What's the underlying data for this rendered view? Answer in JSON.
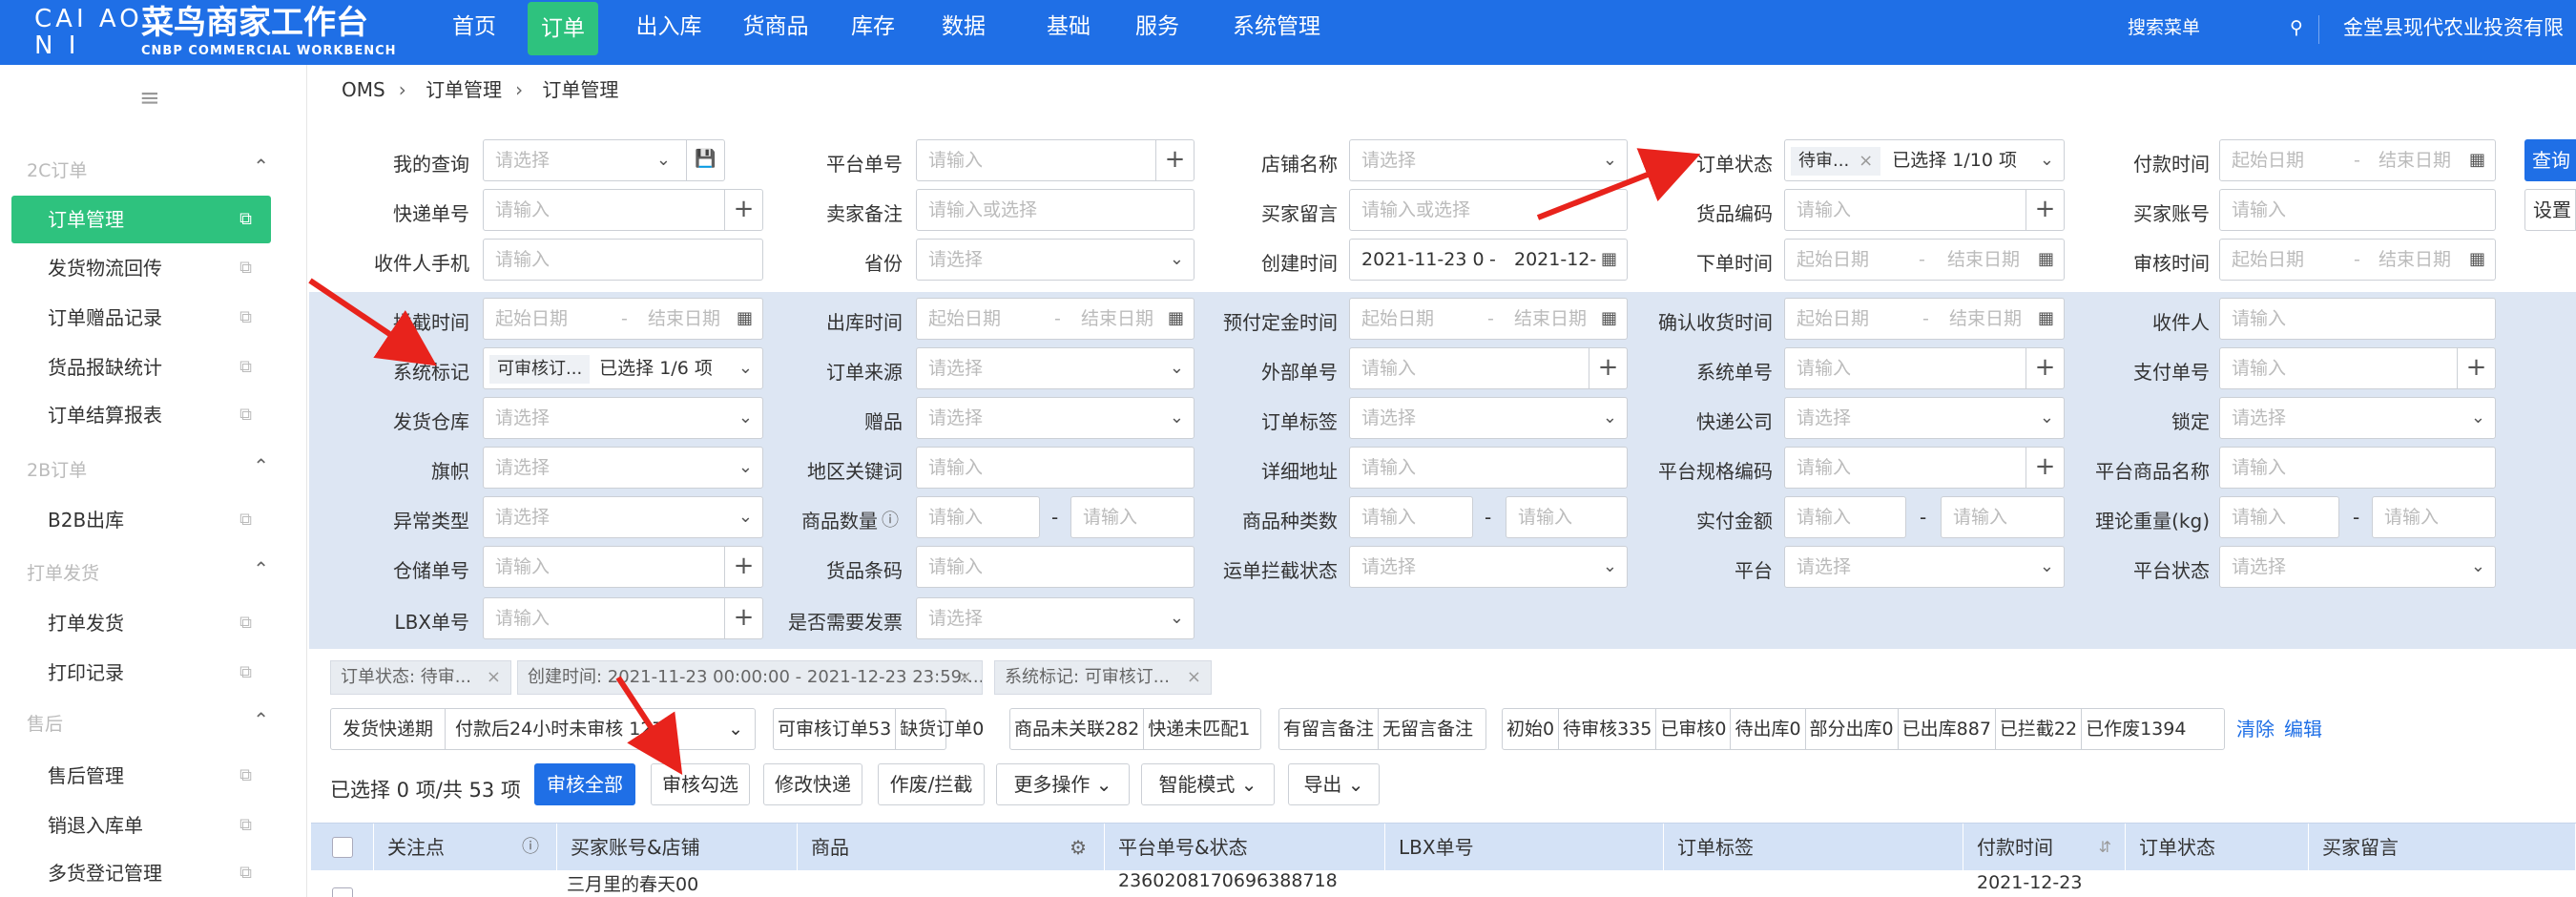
{
  "brand": {
    "logo_line1": "CAI AO",
    "logo_line2": "N I",
    "title": "菜鸟商家工作台",
    "subtitle": "CNBP COMMERCIAL WORKBENCH"
  },
  "nav": [
    "首页",
    "订单",
    "出入库",
    "货商品",
    "库存",
    "数据",
    "基础",
    "服务",
    "系统管理"
  ],
  "topbar": {
    "search_label": "搜索菜单",
    "company": "金堂县现代农业投资有限"
  },
  "sidebar": {
    "collapse_icon": "≡",
    "sections": [
      {
        "title": "2C订单",
        "items": [
          "订单管理",
          "发货物流回传",
          "订单赠品记录",
          "货品报缺统计",
          "订单结算报表"
        ]
      },
      {
        "title": "2B订单",
        "items": [
          "B2B出库"
        ]
      },
      {
        "title": "打单发货",
        "items": [
          "打单发货",
          "打印记录"
        ]
      },
      {
        "title": "售后",
        "items": [
          "售后管理",
          "销退入库单",
          "多货登记管理"
        ]
      }
    ]
  },
  "breadcrumb": [
    "OMS",
    "订单管理",
    "订单管理"
  ],
  "filters": {
    "my_query": {
      "label": "我的查询",
      "placeholder": "请选择"
    },
    "platform_no": {
      "label": "平台单号",
      "placeholder": "请输入"
    },
    "shop_name": {
      "label": "店铺名称",
      "placeholder": "请选择"
    },
    "order_status": {
      "label": "订单状态",
      "tag": "待审...",
      "summary": "已选择 1/10 项"
    },
    "pay_time": {
      "label": "付款时间",
      "start": "起始日期",
      "end": "结束日期"
    },
    "express_no": {
      "label": "快递单号",
      "placeholder": "请输入"
    },
    "seller_note": {
      "label": "卖家备注",
      "placeholder": "请输入或选择"
    },
    "buyer_msg": {
      "label": "买家留言",
      "placeholder": "请输入或选择"
    },
    "goods_code": {
      "label": "货品编码",
      "placeholder": "请输入"
    },
    "buyer_account": {
      "label": "买家账号",
      "placeholder": "请输入"
    },
    "receiver_phone": {
      "label": "收件人手机",
      "placeholder": "请输入"
    },
    "province": {
      "label": "省份",
      "placeholder": "请选择"
    },
    "create_time": {
      "label": "创建时间",
      "start": "2021-11-23 0",
      "end": "2021-12-"
    },
    "order_time": {
      "label": "下单时间",
      "start": "起始日期",
      "end": "结束日期"
    },
    "review_time": {
      "label": "审核时间",
      "start": "起始日期",
      "end": "结束日期"
    },
    "intercept_time": {
      "label": "拦截时间",
      "start": "起始日期",
      "end": "结束日期"
    },
    "out_time": {
      "label": "出库时间",
      "start": "起始日期",
      "end": "结束日期"
    },
    "deposit_time": {
      "label": "预付定金时间",
      "start": "起始日期",
      "end": "结束日期"
    },
    "confirm_time": {
      "label": "确认收货时间",
      "start": "起始日期",
      "end": "结束日期"
    },
    "receiver": {
      "label": "收件人",
      "placeholder": "请输入"
    },
    "sys_mark": {
      "label": "系统标记",
      "tag": "可审核订...",
      "summary": "已选择 1/6 项"
    },
    "order_source": {
      "label": "订单来源",
      "placeholder": "请选择"
    },
    "external_no": {
      "label": "外部单号",
      "placeholder": "请输入"
    },
    "sys_no": {
      "label": "系统单号",
      "placeholder": "请输入"
    },
    "pay_no": {
      "label": "支付单号",
      "placeholder": "请输入"
    },
    "warehouse": {
      "label": "发货仓库",
      "placeholder": "请选择"
    },
    "gift": {
      "label": "赠品",
      "placeholder": "请选择"
    },
    "order_tag": {
      "label": "订单标签",
      "placeholder": "请选择"
    },
    "express_co": {
      "label": "快递公司",
      "placeholder": "请选择"
    },
    "lock": {
      "label": "锁定",
      "placeholder": "请选择"
    },
    "flag": {
      "label": "旗帜",
      "placeholder": "请选择"
    },
    "region_kw": {
      "label": "地区关键词",
      "placeholder": "请输入"
    },
    "address": {
      "label": "详细地址",
      "placeholder": "请输入"
    },
    "platform_spec": {
      "label": "平台规格编码",
      "placeholder": "请输入"
    },
    "platform_goods": {
      "label": "平台商品名称",
      "placeholder": "请输入"
    },
    "exception": {
      "label": "异常类型",
      "placeholder": "请选择"
    },
    "goods_qty": {
      "label": "商品数量",
      "placeholder": "请输入"
    },
    "goods_kinds": {
      "label": "商品种类数",
      "placeholder": "请输入"
    },
    "paid_amount": {
      "label": "实付金额",
      "placeholder": "请输入"
    },
    "weight": {
      "label": "理论重量(kg)",
      "placeholder": "请输入"
    },
    "storage_no": {
      "label": "仓储单号",
      "placeholder": "请输入"
    },
    "barcode": {
      "label": "货品条码",
      "placeholder": "请输入"
    },
    "waybill_status": {
      "label": "运单拦截状态",
      "placeholder": "请选择"
    },
    "platform": {
      "label": "平台",
      "placeholder": "请选择"
    },
    "platform_status": {
      "label": "平台状态",
      "placeholder": "请选择"
    },
    "lbx_no": {
      "label": "LBX单号",
      "placeholder": "请输入"
    },
    "invoice": {
      "label": "是否需要发票",
      "placeholder": "请选择"
    },
    "query_btn": "查询",
    "settings_btn": "设置"
  },
  "active_filters": [
    "订单状态: 待审...",
    "创建时间: 2021-11-23 00:00:00 - 2021-12-23 23:59:...",
    "系统标记: 可审核订..."
  ],
  "quick": {
    "group1": [
      "发货快递期",
      "付款后24小时未审核 127"
    ],
    "group2": [
      "可审核订单53",
      "缺货订单0"
    ],
    "group3": [
      "商品未关联282",
      "快递未匹配1"
    ],
    "group4": [
      "有留言备注",
      "无留言备注"
    ],
    "group5": [
      "初始0",
      "待审核335",
      "已审核0",
      "待出库0",
      "部分出库0",
      "已出库887",
      "已拦截22",
      "已作废1394"
    ],
    "clear": "清除",
    "edit": "编辑"
  },
  "actions": {
    "selected_info": "已选择 0 项/共 53 项",
    "buttons": [
      "审核全部",
      "审核勾选",
      "修改快递",
      "作废/拦截",
      "更多操作",
      "智能模式",
      "导出"
    ]
  },
  "table": {
    "headers": [
      "关注点",
      "买家账号&店铺",
      "商品",
      "平台单号&状态",
      "LBX单号",
      "订单标签",
      "付款时间",
      "订单状态",
      "买家留言"
    ],
    "row1": {
      "buyer": "三月里的春天00",
      "platform_no": "2360208170696388718",
      "pay_time": "2021-12-23"
    }
  },
  "colors": {
    "topbar": "#1f6fe6",
    "active": "#2ec27e",
    "band": "#dde6f3",
    "annotation": "#e8231c"
  }
}
